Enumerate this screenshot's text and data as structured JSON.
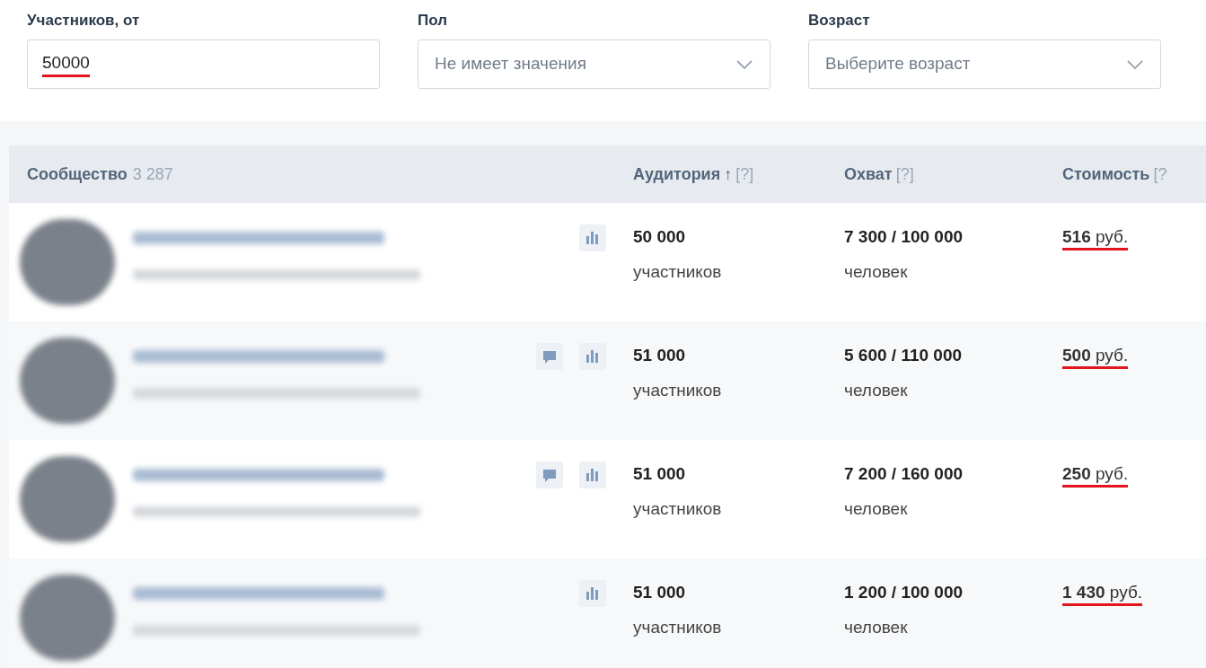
{
  "filters": [
    {
      "label": "Участников, от",
      "kind": "input",
      "value": "50000",
      "underlined": true
    },
    {
      "label": "Пол",
      "kind": "select",
      "placeholder": "Не имеет значения"
    },
    {
      "label": "Возраст",
      "kind": "select",
      "placeholder": "Выберите возраст"
    }
  ],
  "table": {
    "columns": [
      {
        "title": "Сообщество",
        "count": "3 287"
      },
      {
        "title": "Аудитория",
        "sort": "↑",
        "hint": "[?]"
      },
      {
        "title": "Охват",
        "hint": "[?]"
      },
      {
        "title": "Стоимость",
        "hint": "[?"
      }
    ],
    "rows": [
      {
        "comments_icon": false,
        "audience": "50 000",
        "audience_unit": "участников",
        "reach": "7 300 / 100 000",
        "reach_unit": "человек",
        "price": "**516** руб.",
        "underlined": true
      },
      {
        "comments_icon": true,
        "audience": "51 000",
        "audience_unit": "участников",
        "reach": "5 600 / 110 000",
        "reach_unit": "человек",
        "price": "**500** руб.",
        "underlined": true
      },
      {
        "comments_icon": true,
        "audience": "51 000",
        "audience_unit": "участников",
        "reach": "7 200 / 160 000",
        "reach_unit": "человек",
        "price": "**250** руб.",
        "underlined": true
      },
      {
        "comments_icon": false,
        "audience": "51 000",
        "audience_unit": "участников",
        "reach": "1 200 / 100 000",
        "reach_unit": "человек",
        "price": "**1 430** руб.",
        "underlined": true
      }
    ]
  }
}
